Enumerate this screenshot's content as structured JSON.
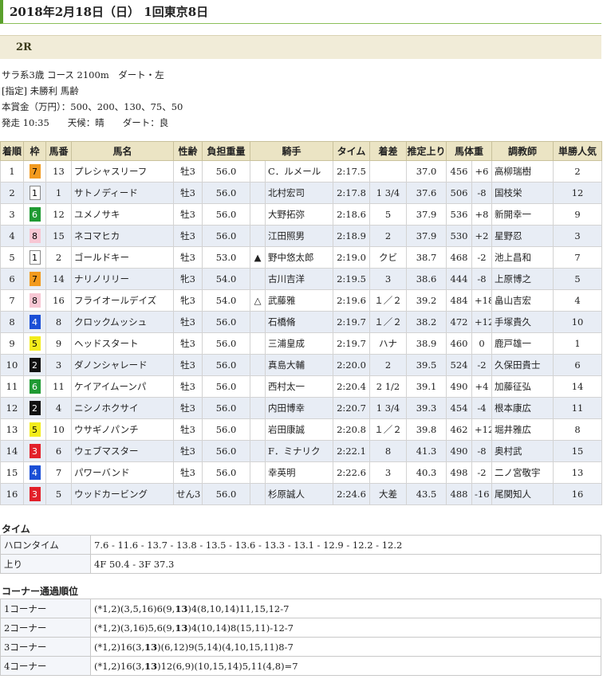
{
  "header": {
    "title": "2018年2月18日（日） 1回東京8日"
  },
  "race": {
    "number": "2R",
    "lines": [
      "サラ系3歳 コース 2100m　ダート・左",
      "[指定] 未勝利 馬齢",
      "本賞金（万円）：500、200、130、75、50",
      "発走 10:35　　天候：晴　　ダート：良"
    ]
  },
  "table": {
    "headers": [
      "着順",
      "枠",
      "馬番",
      "馬名",
      "性齢",
      "負担重量",
      "騎手",
      "タイム",
      "着差",
      "推定上り",
      "馬体重",
      "調教師",
      "単勝人気"
    ],
    "rows": [
      {
        "rank": "1",
        "waku": "7",
        "num": "13",
        "name": "プレシャスリーフ",
        "sex": "牡3",
        "weight": "56.0",
        "mark": "",
        "jockey": "C．ルメール",
        "time": "2:17.5",
        "margin": "",
        "last": "37.0",
        "bw": "456",
        "diff": "+6",
        "trainer": "高柳瑞樹",
        "pop": "2"
      },
      {
        "rank": "2",
        "waku": "1",
        "num": "1",
        "name": "サトノディード",
        "sex": "牡3",
        "weight": "56.0",
        "mark": "",
        "jockey": "北村宏司",
        "time": "2:17.8",
        "margin": "1 3/4",
        "last": "37.6",
        "bw": "506",
        "diff": "-8",
        "trainer": "国枝栄",
        "pop": "12"
      },
      {
        "rank": "3",
        "waku": "6",
        "num": "12",
        "name": "ユメノサキ",
        "sex": "牡3",
        "weight": "56.0",
        "mark": "",
        "jockey": "大野拓弥",
        "time": "2:18.6",
        "margin": "5",
        "last": "37.9",
        "bw": "536",
        "diff": "+8",
        "trainer": "新開幸一",
        "pop": "9"
      },
      {
        "rank": "4",
        "waku": "8",
        "num": "15",
        "name": "ネコマヒカ",
        "sex": "牡3",
        "weight": "56.0",
        "mark": "",
        "jockey": "江田照男",
        "time": "2:18.9",
        "margin": "2",
        "last": "37.9",
        "bw": "530",
        "diff": "+2",
        "trainer": "星野忍",
        "pop": "3"
      },
      {
        "rank": "5",
        "waku": "1",
        "num": "2",
        "name": "ゴールドキー",
        "sex": "牡3",
        "weight": "53.0",
        "mark": "▲",
        "jockey": "野中悠太郎",
        "time": "2:19.0",
        "margin": "クビ",
        "last": "38.7",
        "bw": "468",
        "diff": "-2",
        "trainer": "池上昌和",
        "pop": "7"
      },
      {
        "rank": "6",
        "waku": "7",
        "num": "14",
        "name": "ナリノリリー",
        "sex": "牝3",
        "weight": "54.0",
        "mark": "",
        "jockey": "古川吉洋",
        "time": "2:19.5",
        "margin": "3",
        "last": "38.6",
        "bw": "444",
        "diff": "-8",
        "trainer": "上原博之",
        "pop": "5"
      },
      {
        "rank": "7",
        "waku": "8",
        "num": "16",
        "name": "フライオールデイズ",
        "sex": "牝3",
        "weight": "54.0",
        "mark": "△",
        "jockey": "武藤雅",
        "time": "2:19.6",
        "margin": "１／２",
        "last": "39.2",
        "bw": "484",
        "diff": "+18",
        "trainer": "畠山吉宏",
        "pop": "4"
      },
      {
        "rank": "8",
        "waku": "4",
        "num": "8",
        "name": "クロックムッシュ",
        "sex": "牡3",
        "weight": "56.0",
        "mark": "",
        "jockey": "石橋脩",
        "time": "2:19.7",
        "margin": "１／２",
        "last": "38.2",
        "bw": "472",
        "diff": "+12",
        "trainer": "手塚貴久",
        "pop": "10"
      },
      {
        "rank": "9",
        "waku": "5",
        "num": "9",
        "name": "ヘッドスタート",
        "sex": "牡3",
        "weight": "56.0",
        "mark": "",
        "jockey": "三浦皇成",
        "time": "2:19.7",
        "margin": "ハナ",
        "last": "38.9",
        "bw": "460",
        "diff": "0",
        "trainer": "鹿戸雄一",
        "pop": "1"
      },
      {
        "rank": "10",
        "waku": "2",
        "num": "3",
        "name": "ダノンシャレード",
        "sex": "牡3",
        "weight": "56.0",
        "mark": "",
        "jockey": "真島大輔",
        "time": "2:20.0",
        "margin": "2",
        "last": "39.5",
        "bw": "524",
        "diff": "-2",
        "trainer": "久保田貴士",
        "pop": "6"
      },
      {
        "rank": "11",
        "waku": "6",
        "num": "11",
        "name": "ケイアイムーンパ",
        "sex": "牡3",
        "weight": "56.0",
        "mark": "",
        "jockey": "西村太一",
        "time": "2:20.4",
        "margin": "2 1/2",
        "last": "39.1",
        "bw": "490",
        "diff": "+4",
        "trainer": "加藤征弘",
        "pop": "14"
      },
      {
        "rank": "12",
        "waku": "2",
        "num": "4",
        "name": "ニシノホクサイ",
        "sex": "牡3",
        "weight": "56.0",
        "mark": "",
        "jockey": "内田博幸",
        "time": "2:20.7",
        "margin": "1 3/4",
        "last": "39.3",
        "bw": "454",
        "diff": "-4",
        "trainer": "根本康広",
        "pop": "11"
      },
      {
        "rank": "13",
        "waku": "5",
        "num": "10",
        "name": "ウサギノパンチ",
        "sex": "牡3",
        "weight": "56.0",
        "mark": "",
        "jockey": "岩田康誠",
        "time": "2:20.8",
        "margin": "１／２",
        "last": "39.8",
        "bw": "462",
        "diff": "+12",
        "trainer": "堀井雅広",
        "pop": "8"
      },
      {
        "rank": "14",
        "waku": "3",
        "num": "6",
        "name": "ウェブマスター",
        "sex": "牡3",
        "weight": "56.0",
        "mark": "",
        "jockey": "F．ミナリク",
        "time": "2:22.1",
        "margin": "8",
        "last": "41.3",
        "bw": "490",
        "diff": "-8",
        "trainer": "奥村武",
        "pop": "15"
      },
      {
        "rank": "15",
        "waku": "4",
        "num": "7",
        "name": "パワーバンド",
        "sex": "牡3",
        "weight": "56.0",
        "mark": "",
        "jockey": "幸英明",
        "time": "2:22.6",
        "margin": "3",
        "last": "40.3",
        "bw": "498",
        "diff": "-2",
        "trainer": "二ノ宮敬宇",
        "pop": "13"
      },
      {
        "rank": "16",
        "waku": "3",
        "num": "5",
        "name": "ウッドカービング",
        "sex": "せん3",
        "weight": "56.0",
        "mark": "",
        "jockey": "杉原誠人",
        "time": "2:24.6",
        "margin": "大差",
        "last": "43.5",
        "bw": "488",
        "diff": "-16",
        "trainer": "尾関知人",
        "pop": "16"
      }
    ]
  },
  "waku_colors": {
    "1": {
      "bg": "#ffffff",
      "fg": "#000000"
    },
    "2": {
      "bg": "#111111",
      "fg": "#ffffff"
    },
    "3": {
      "bg": "#e2202a",
      "fg": "#ffffff"
    },
    "4": {
      "bg": "#1b4fd6",
      "fg": "#ffffff"
    },
    "5": {
      "bg": "#f3ec1c",
      "fg": "#000000"
    },
    "6": {
      "bg": "#1f9a33",
      "fg": "#ffffff"
    },
    "7": {
      "bg": "#f29a1e",
      "fg": "#000000"
    },
    "8": {
      "bg": "#f7c6d3",
      "fg": "#000000"
    }
  },
  "time_section": {
    "title": "タイム",
    "rows": [
      {
        "label": "ハロンタイム",
        "value": "7.6 - 11.6 - 13.7 - 13.8 - 13.5 - 13.6 - 13.3 - 13.1 - 12.9 - 12.2 - 12.2"
      },
      {
        "label": "上り",
        "value": "4F 50.4 - 3F 37.3"
      }
    ]
  },
  "corner_section": {
    "title": "コーナー通過順位",
    "rows": [
      {
        "label": "1コーナー",
        "parts": [
          [
            "(*1,2)(3,5,16)6(9,",
            false
          ],
          [
            "13",
            true
          ],
          [
            ")4(8,10,14)11,15,12-7",
            false
          ]
        ]
      },
      {
        "label": "2コーナー",
        "parts": [
          [
            "(*1,2)(3,16)5,6(9,",
            false
          ],
          [
            "13",
            true
          ],
          [
            ")4(10,14)8(15,11)-12-7",
            false
          ]
        ]
      },
      {
        "label": "3コーナー",
        "parts": [
          [
            "(*1,2)16(3,",
            false
          ],
          [
            "13",
            true
          ],
          [
            ")(6,12)9(5,14)(4,10,15,11)8-7",
            false
          ]
        ]
      },
      {
        "label": "4コーナー",
        "parts": [
          [
            "(*1,2)16(3,",
            false
          ],
          [
            "13",
            true
          ],
          [
            ")12(6,9)(10,15,14)5,11(4,8)=7",
            false
          ]
        ]
      }
    ]
  }
}
